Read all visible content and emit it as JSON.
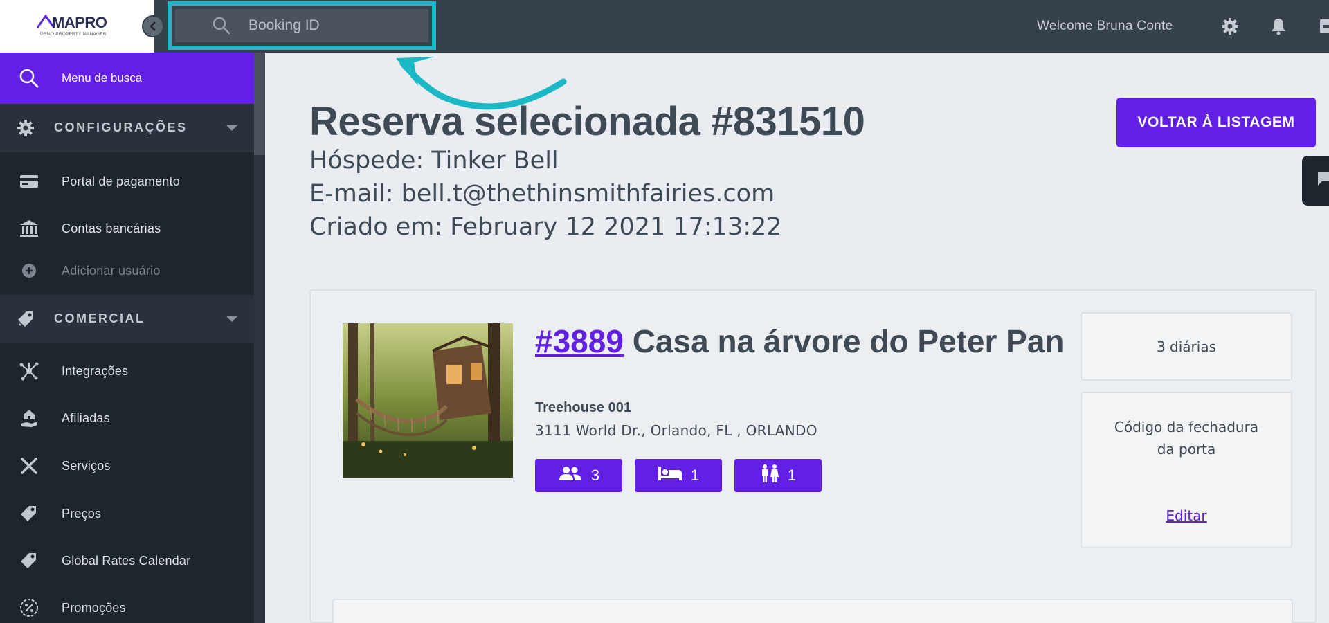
{
  "header": {
    "logo_text": "MAPRO",
    "logo_subtitle": "DEMO PROPERTY MANAGER",
    "search_placeholder": "Booking ID",
    "welcome": "Welcome Bruna Conte",
    "icons": [
      "gear-icon",
      "bell-icon",
      "logout-icon"
    ]
  },
  "sidebar": {
    "search_label": "Menu de busca",
    "sections": [
      {
        "label": "CONFIGURAÇÕES",
        "items": [
          {
            "label": "Portal de pagamento",
            "icon": "credit-card-icon"
          },
          {
            "label": "Contas bancárias",
            "icon": "bank-icon"
          },
          {
            "label": "Adicionar usuário",
            "icon": "plus-circle-icon"
          }
        ]
      },
      {
        "label": "COMERCIAL",
        "items": [
          {
            "label": "Integrações",
            "icon": "network-icon"
          },
          {
            "label": "Afiliadas",
            "icon": "hand-house-icon"
          },
          {
            "label": "Serviços",
            "icon": "tools-icon"
          },
          {
            "label": "Preços",
            "icon": "tags-icon"
          },
          {
            "label": "Global Rates Calendar",
            "icon": "tags-icon"
          },
          {
            "label": "Promoções",
            "icon": "percent-icon"
          }
        ]
      }
    ]
  },
  "main": {
    "title": "Reserva selecionada #831510",
    "guest": "Hóspede: Tinker Bell",
    "email": "E-mail: bell.t@thethinsmithfairies.com",
    "created": "Criado em: February 12 2021 17:13:22",
    "back_button": "VOLTAR À LISTAGEM",
    "property": {
      "id_link": "#3889",
      "name": "Casa na árvore do Peter Pan",
      "unit": "Treehouse 001",
      "address": "3111 World Dr., Orlando, FL , ORLANDO",
      "guests": "3",
      "beds": "1",
      "bathrooms": "1"
    },
    "nights": "3 diárias",
    "lock_code_label": "Código da fechadura da porta",
    "edit_link": "Editar"
  },
  "colors": {
    "accent": "#6220e5",
    "highlight": "#1bb9c6",
    "topbar": "#37414b",
    "sidebar": "#1e252d"
  }
}
